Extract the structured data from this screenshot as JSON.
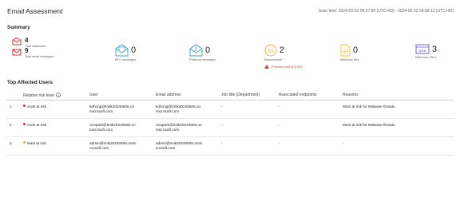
{
  "page": {
    "title": "Email Assessment",
    "scan_time": "Scan time: 2024-05-22 04:37:54 (UTC+00) - 2024-05-22 04:58:12 (UTC+00)"
  },
  "summary": {
    "heading": "Summary",
    "total_mailboxes": {
      "value": "4",
      "label": "Total mailboxes"
    },
    "total_email_messages": {
      "value": "9",
      "label": "Total email messages"
    },
    "bec": {
      "value": "0",
      "label": "BEC messages",
      "icon": "bec-mail-icon"
    },
    "phishing": {
      "value": "0",
      "label": "Phishing messages",
      "icon": "phishing-mail-icon"
    },
    "ransomware": {
      "value": "2",
      "label": "Ransomware",
      "icon": "ransomware-icon",
      "potential_cost": "Potential cost: $72,590"
    },
    "malicious_files": {
      "value": "0",
      "label": "Malicious files",
      "icon": "file-icon"
    },
    "malicious_urls": {
      "value": "3",
      "label": "Malicious URLs",
      "icon": "url-icon"
    }
  },
  "affected_users": {
    "heading": "Top Affected Users",
    "columns": [
      "Relative risk level",
      "User",
      "Email address",
      "Job title (Department)",
      "Associated endpoints",
      "Reasons"
    ],
    "rows": [
      {
        "index": "1",
        "risk": "most at risk",
        "user": "kdhong@tmik20240506.on microsoft.com",
        "email": "kdhong@tmik20240506.on microsoft.com",
        "job": "-",
        "endpoints": "-",
        "reasons": "Most at risk for Malware threats"
      },
      {
        "index": "2",
        "risk": "most at risk",
        "user": "rmspark@tmik20240506.on microsoft.com",
        "email": "rmspark@tmik20240506.on microsoft.com",
        "job": "-",
        "endpoints": "-",
        "reasons": "Most at risk for Malware threats"
      },
      {
        "index": "3",
        "risk": "least at risk",
        "user": "admin@tmik20240506.onmi crosoft.com",
        "email": "admin@tmik20240506.onmi crosoft.com",
        "job": "-",
        "endpoints": "-",
        "reasons": "-"
      }
    ]
  },
  "colors": {
    "most_at_risk": "#d13438",
    "least_at_risk": "#f7a325",
    "teal_icon": "#3aa6c9",
    "ransom_icon": "#f5b33a",
    "file_icon": "#f5c243",
    "url_icon": "#7160e8",
    "mailbox_icon": "#d13438",
    "warning_text": "#c4462f"
  }
}
